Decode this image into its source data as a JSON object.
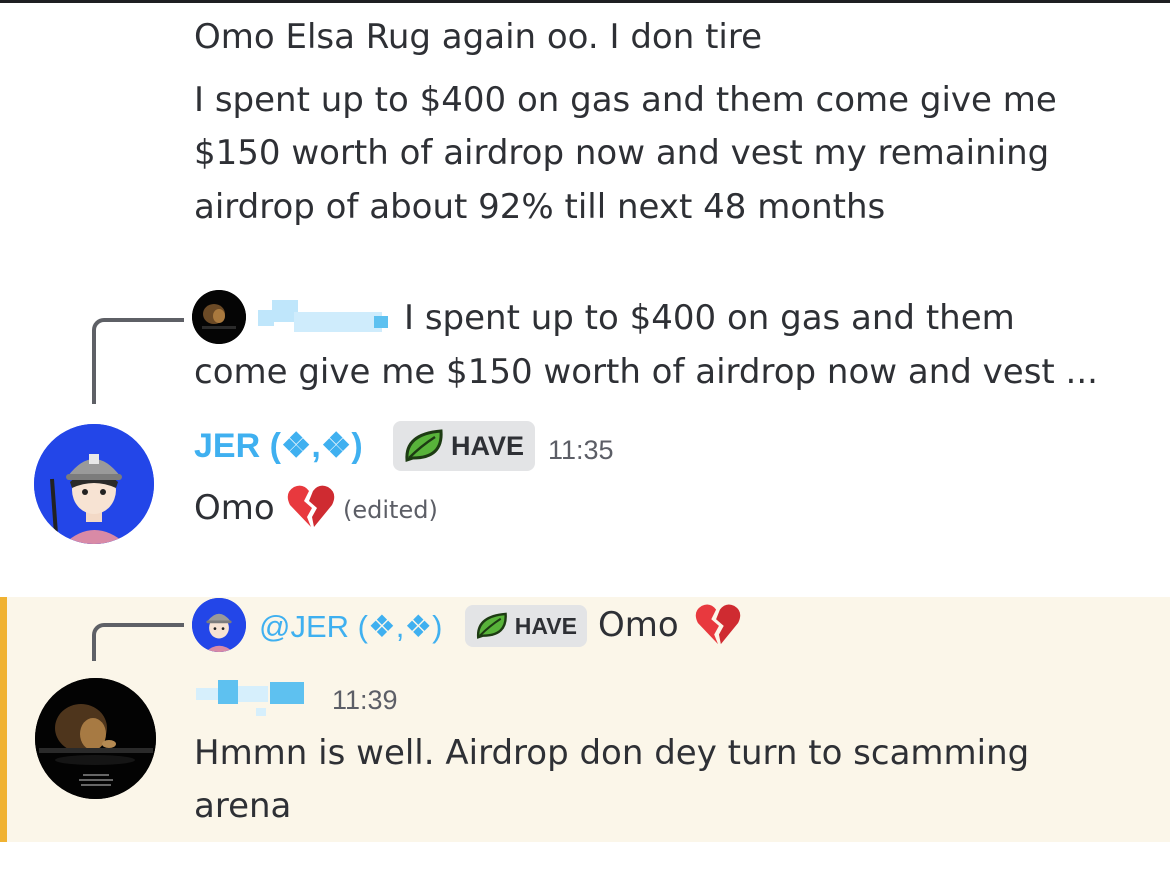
{
  "messages": {
    "first": {
      "line1": "Omo Elsa Rug again oo. I don tire",
      "line2": "I spent up to $400 on gas and them come give me",
      "line3": "$150 worth of airdrop now and vest my remaining",
      "line4": "airdrop of about 92% till next 48 months"
    },
    "second": {
      "reply_line1": "I spent up to $400 on gas and them",
      "reply_line2": "come give me $150 worth of airdrop now and vest ...",
      "username": "JER (❖,❖)",
      "tag": "HAVE",
      "time": "11:35",
      "content": "Omo",
      "edited": "(edited)"
    },
    "third": {
      "reply_username": "@JER (❖,❖)",
      "reply_tag": "HAVE",
      "reply_content": "Omo",
      "time": "11:39",
      "content_line1": "Hmmn is well. Airdrop don dey turn to scamming",
      "content_line2": "arena"
    }
  },
  "colors": {
    "username": "#3fb0f0",
    "highlight_bg": "#fbf6e9",
    "highlight_border": "#f0b232",
    "broken_heart": "#e8393e"
  },
  "icons": [
    "broken-heart-icon",
    "leaf-icon",
    "avatar-anime-boy",
    "avatar-lion"
  ]
}
